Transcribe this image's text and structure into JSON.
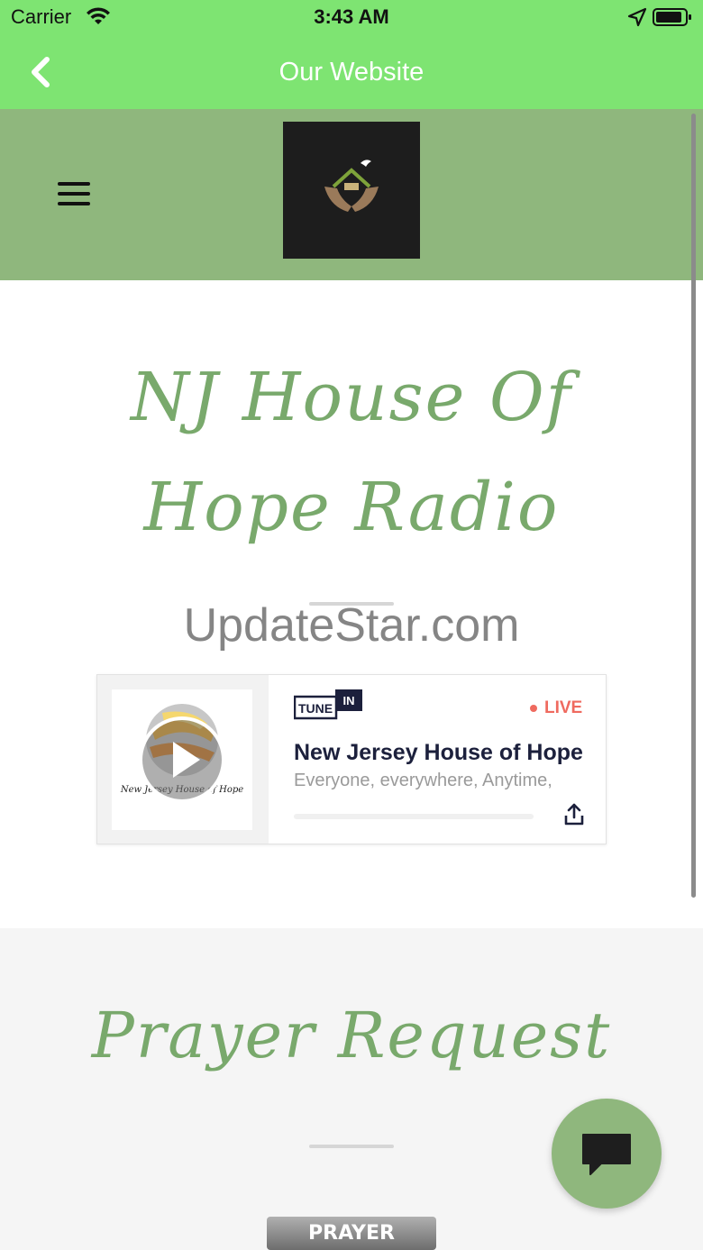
{
  "status_bar": {
    "carrier": "Carrier",
    "time": "3:43 AM"
  },
  "nav": {
    "title": "Our Website"
  },
  "site": {
    "headline": "NJ House Of Hope Radio",
    "watermark": "UpdateStar.com"
  },
  "player": {
    "art_caption": "New Jersey House of Hope",
    "brand_left": "TUNE",
    "brand_right": "IN",
    "live_label": "LIVE",
    "station_name": "New Jersey House of Hope",
    "slogan": "Everyone, everywhere, Anytime,"
  },
  "prayer": {
    "title": "Prayer Request",
    "button_label": "PRAYER REQUEST"
  },
  "colors": {
    "header_green": "#7ee472",
    "site_header": "#8fb77d",
    "accent_text": "#79a96c",
    "live_red": "#ef6a5f"
  }
}
